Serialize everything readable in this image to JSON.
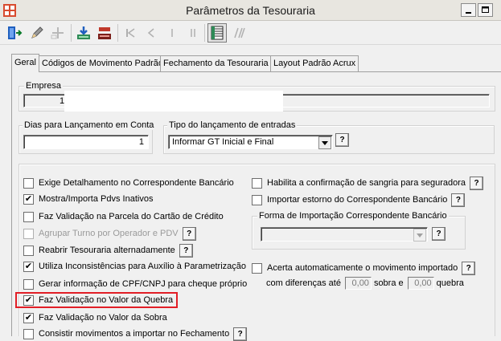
{
  "window": {
    "title": "Parâmetros da Tesouraria"
  },
  "tabs": [
    {
      "label": "Geral"
    },
    {
      "label": "Códigos de Movimento Padrão"
    },
    {
      "label": "Fechamento da Tesouraria"
    },
    {
      "label": "Layout Padrão Acrux"
    }
  ],
  "empresa": {
    "legend": "Empresa",
    "code": "1"
  },
  "dias": {
    "legend": "Dias para Lançamento em Conta",
    "value": "1"
  },
  "tipo": {
    "legend": "Tipo do lançamento de entradas",
    "selected": "Informar GT Inicial e Final",
    "help": "?"
  },
  "left_options": [
    {
      "label": "Exige Detalhamento no Correspondente Bancário",
      "checked": false,
      "disabled": false
    },
    {
      "label": "Mostra/Importa Pdvs Inativos",
      "checked": true,
      "disabled": false
    },
    {
      "label": "Faz Validação na Parcela do Cartão de Crédito",
      "checked": false,
      "disabled": false
    },
    {
      "label": "Agrupar Turno por Operador e PDV",
      "checked": false,
      "disabled": true,
      "help": "?"
    },
    {
      "label": "Reabrir Tesouraria alternadamente",
      "checked": false,
      "disabled": false,
      "help": "?"
    },
    {
      "label": "Utiliza Inconsistências para Auxílio à Parametrização",
      "checked": true,
      "disabled": false
    },
    {
      "label": "Gerar informação de CPF/CNPJ para cheque próprio",
      "checked": false,
      "disabled": false
    },
    {
      "label": "Faz Validação no Valor da Quebra",
      "checked": true,
      "disabled": false
    },
    {
      "label": "Faz Validação no Valor da Sobra",
      "checked": true,
      "disabled": false
    },
    {
      "label": "Consistir movimentos a importar no Fechamento",
      "checked": false,
      "disabled": false,
      "help": "?"
    }
  ],
  "right_options": [
    {
      "label": "Habilita a confirmação de sangria para seguradora",
      "checked": false,
      "help": "?"
    },
    {
      "label": "Importar estorno do Correspondente Bancário",
      "checked": false,
      "help": "?"
    }
  ],
  "forma_importacao": {
    "legend": "Forma de Importação Correspondente Bancário",
    "selected": "",
    "help": "?"
  },
  "acerto": {
    "label": "Acerta automaticamente o movimento importado",
    "help": "?",
    "prefix": "com diferenças até",
    "sobra_value": "0,00",
    "sobra_label": "sobra e",
    "quebra_value": "0,00",
    "quebra_label": "quebra",
    "checked": false
  },
  "check_mark": "✔",
  "colors": {
    "highlight": "#e21e26",
    "toolbar_icon_blue": "#1f5fbf",
    "toolbar_icon_red": "#c0392b",
    "toolbar_icon_green": "#2e8b57"
  }
}
